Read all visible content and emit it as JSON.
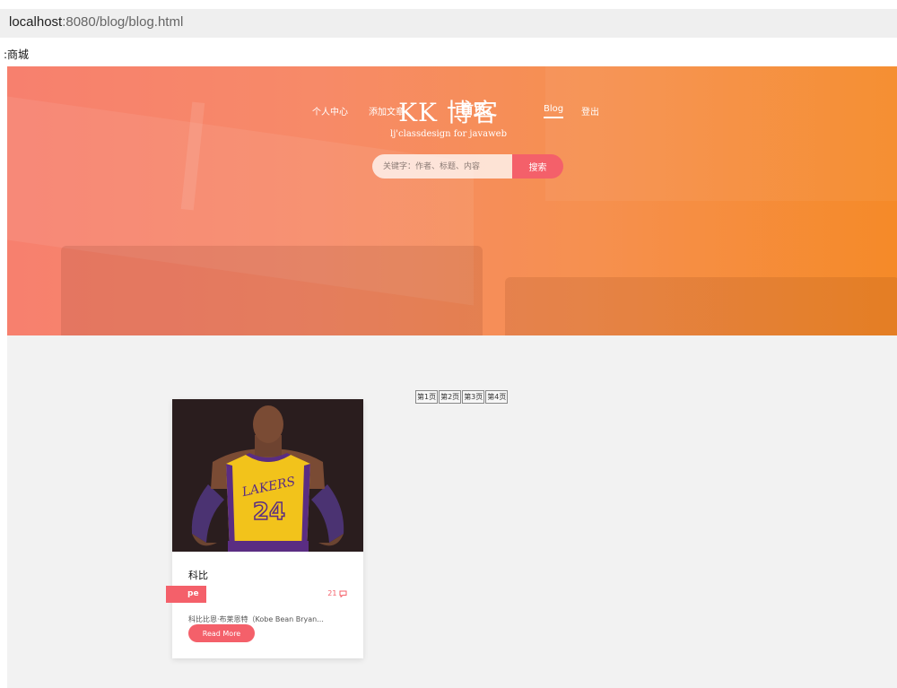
{
  "browser": {
    "url_host": "localhost",
    "url_rest": ":8080/blog/blog.html"
  },
  "bookmarks": {
    "item": ":商城"
  },
  "nav": {
    "personal": "个人中心",
    "add_article": "添加文章",
    "home": "首页。",
    "blog": "Blog",
    "logout": "登出"
  },
  "hero": {
    "title": "KK 博客",
    "subtitle": "lj'classdesign for javaweb"
  },
  "search": {
    "placeholder": "关键字：作者、标题、内容",
    "button": "搜索"
  },
  "pagination": [
    "第1页",
    "第2页",
    "第3页",
    "第4页"
  ],
  "posts": [
    {
      "title": "科比",
      "tag": "pe",
      "comments": "21",
      "excerpt": "科比比恩·布莱恩特（Kobe Bean Bryan...",
      "read_more": "Read More",
      "jersey_text": "LAKERS",
      "jersey_number": "24"
    }
  ],
  "colors": {
    "accent": "#f4606a",
    "hero_left": "#f7806e",
    "hero_right": "#f58a28",
    "content_bg": "#f2f2f2"
  }
}
